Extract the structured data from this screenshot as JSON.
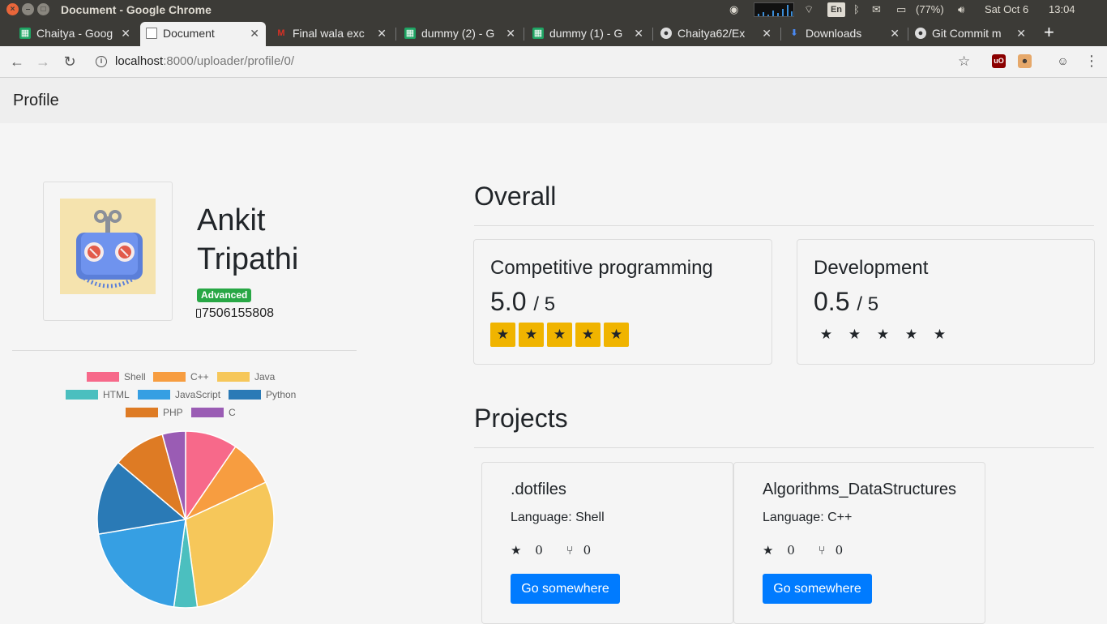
{
  "os": {
    "window_title": "Document - Google Chrome",
    "keyboard_layout": "En",
    "battery": "(77%)",
    "date": "Sat Oct  6",
    "time": "13:04"
  },
  "browser": {
    "tabs": [
      {
        "label": "Chaitya - Goog",
        "icon": "sheets-icon",
        "active": false
      },
      {
        "label": "Document",
        "icon": "document-icon",
        "active": true
      },
      {
        "label": "Final wala exc",
        "icon": "gmail-icon",
        "active": false
      },
      {
        "label": "dummy (2) - G",
        "icon": "sheets-icon",
        "active": false
      },
      {
        "label": "dummy (1) - G",
        "icon": "sheets-icon",
        "active": false
      },
      {
        "label": "Chaitya62/Ex",
        "icon": "github-icon",
        "active": false
      },
      {
        "label": "Downloads",
        "icon": "download-icon",
        "active": false
      },
      {
        "label": "Git Commit m",
        "icon": "github-icon",
        "active": false
      }
    ],
    "url_host": "localhost",
    "url_rest": ":8000/uploader/profile/0/"
  },
  "page": {
    "brand": "Profile",
    "user": {
      "first_name": "Ankit",
      "last_name": "Tripathi",
      "level": "Advanced",
      "phone": "7506155808"
    },
    "language_chart": {
      "type": "pie",
      "legend": [
        "Shell",
        "C++",
        "Java",
        "HTML",
        "JavaScript",
        "Python",
        "PHP",
        "C"
      ],
      "colors": [
        "#f7698a",
        "#f79d40",
        "#f6c75a",
        "#4bbfbf",
        "#369fe3",
        "#2a7ab6",
        "#de7b24",
        "#9a5cb4"
      ],
      "values": [
        9,
        8,
        28,
        4,
        19,
        13,
        9,
        4
      ]
    },
    "overall": {
      "title": "Overall",
      "cards": [
        {
          "title": "Competitive programming",
          "score": "5.0",
          "max": "/ 5",
          "rating": 5
        },
        {
          "title": "Development",
          "score": "0.5",
          "max": "/ 5",
          "rating": 0
        }
      ]
    },
    "projects": {
      "title": "Projects",
      "items": [
        {
          "name": ".dotfiles",
          "language": "Language: Shell",
          "stars": "0",
          "forks": "0",
          "button": "Go somewhere"
        },
        {
          "name": "Algorithms_DataStructures",
          "language": "Language: C++",
          "stars": "0",
          "forks": "0",
          "button": "Go somewhere"
        }
      ]
    }
  }
}
